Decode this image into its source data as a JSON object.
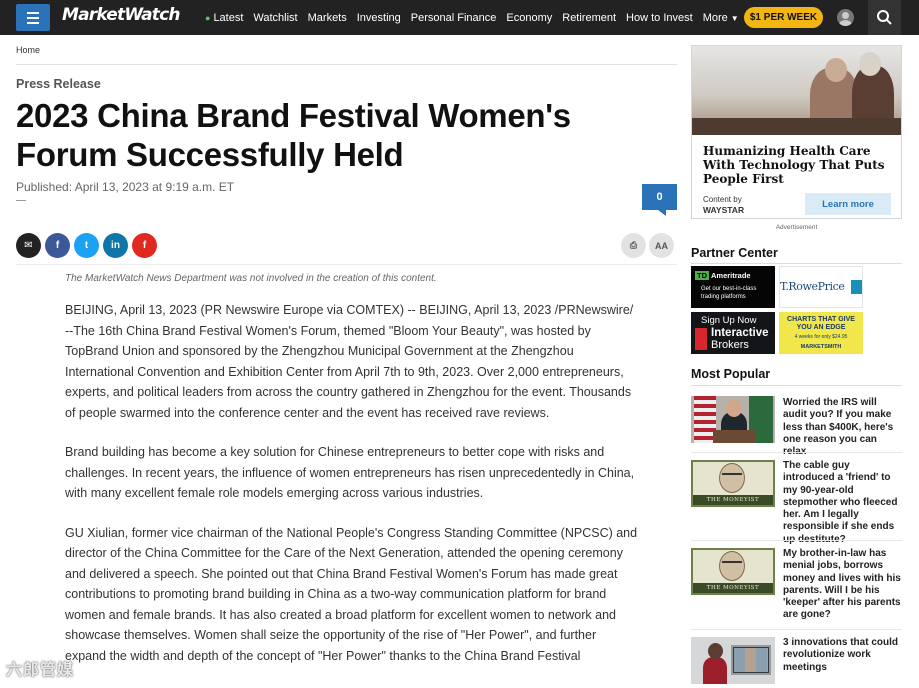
{
  "nav": {
    "logo": "MarketWatch",
    "links": [
      "Latest",
      "Watchlist",
      "Markets",
      "Investing",
      "Personal Finance",
      "Economy",
      "Retirement",
      "How to Invest",
      "More"
    ],
    "subscribe": "$1 PER WEEK"
  },
  "breadcrumb": "Home",
  "article": {
    "kicker": "Press Release",
    "headline": "2023 China Brand Festival Women's Forum Successfully Held",
    "published": "Published: April 13, 2023 at 9:19 a.m. ET",
    "comment_count": "0",
    "disclaimer": "The MarketWatch News Department was not involved in the creation of this content.",
    "paragraphs": [
      "BEIJING, April 13, 2023 (PR Newswire Europe via COMTEX) -- BEIJING, April 13, 2023 /PRNewswire/ --The 16th China Brand Festival Women's Forum, themed \"Bloom Your Beauty\", was hosted by TopBrand Union and sponsored by the Zhengzhou Municipal Government at the Zhengzhou International Convention and Exhibition Center from April 7th to 9th, 2023. Over 2,000 entrepreneurs, experts, and political leaders from across the country gathered in Zhengzhou for the event. Thousands of people swarmed into the conference center and the event has received rave reviews.",
      "Brand building has become a key solution for Chinese entrepreneurs to better cope with risks and challenges. In recent years, the influence of women entrepreneurs has risen unprecedentedly in China, with many excellent female role models emerging across various industries.",
      "GU Xiulian, former vice chairman of the National People's Congress Standing Committee (NPCSC) and director of the China Committee for the Care of the Next Generation, attended the opening ceremony and delivered a speech. She pointed out that China Brand Festival Women's Forum has made great contributions to promoting brand building in China as a two-way communication platform for brand women and female brands. It has also created a broad platform for excellent women to network and showcase themselves. Women shall seize the opportunity of the rise of \"Her Power\", and further expand the width and depth of the concept of \"Her Power\" thanks to the China Brand Festival"
    ]
  },
  "share": {
    "email": "✉",
    "facebook": "f",
    "twitter": "t",
    "linkedin": "in",
    "flipboard": "f",
    "print": "⎙",
    "text_size": "AA"
  },
  "ad": {
    "title": "Humanizing Health Care With Technology That Puts People First",
    "content_by": "Content by",
    "sponsor": "WAYSTAR",
    "cta": "Learn more",
    "label": "Advertisement"
  },
  "partner_center": {
    "heading": "Partner Center",
    "td_brand": "Ameritrade",
    "td_tagline": "Get our best-in-class trading platforms",
    "trowe": "T.RowePrice",
    "ib_line1": "Sign Up Now",
    "ib_line2": "Interactive",
    "ib_line3": "Brokers",
    "ms_line1": "CHARTS THAT GIVE YOU AN EDGE",
    "ms_line2": "4 weeks for only $24.95",
    "ms_brand": "MARKETSMITH"
  },
  "most_popular": {
    "heading": "Most Popular",
    "items": [
      {
        "title": "Worried the IRS will audit you? If you make less than $400K, here's one reason you can relax"
      },
      {
        "title": "The cable guy introduced a 'friend' to my 90-year-old stepmother who fleeced her. Am I legally responsible if she ends up destitute?",
        "caption": "THE MONEYIST"
      },
      {
        "title": "My brother-in-law has menial jobs, borrows money and lives with his parents. Will I be his 'keeper' after his parents are gone?",
        "caption": "THE MONEYIST"
      },
      {
        "title": "3 innovations that could revolutionize work meetings"
      }
    ]
  },
  "watermark": "六郎管媒",
  "colors": {
    "nav_bg": "#222222",
    "accent_blue": "#2a73b8",
    "subscribe_yellow": "#f3b511",
    "live_dot": "#4cc86a"
  }
}
